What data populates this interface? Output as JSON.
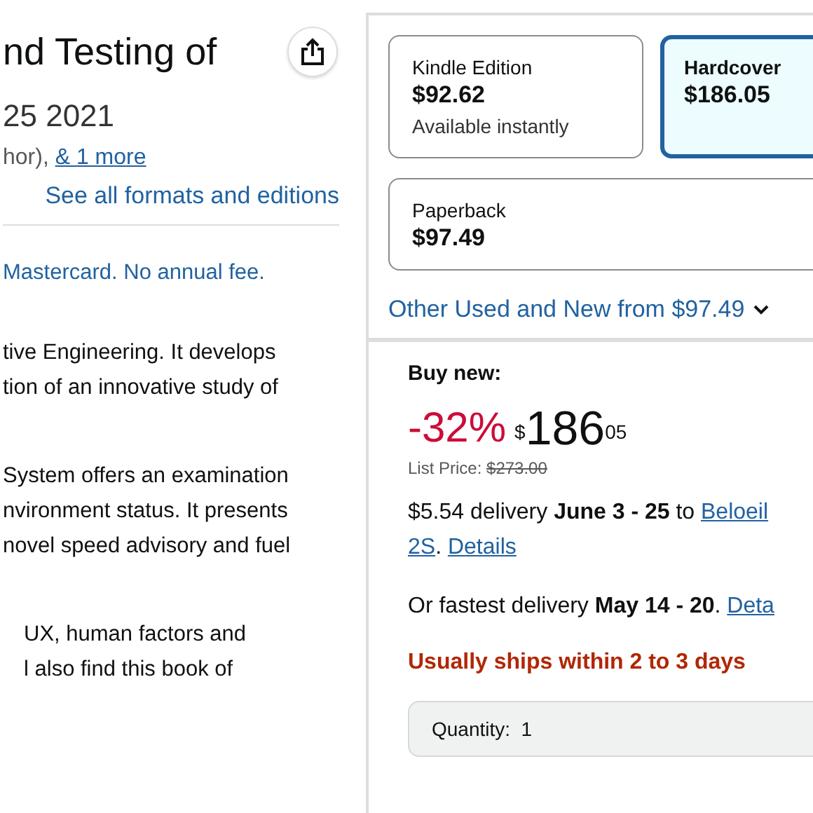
{
  "title": "nd Testing of",
  "subtitle": "25 2021",
  "byline": {
    "text": "hor), ",
    "link": "& 1 more"
  },
  "formats_link": "See all formats and editions",
  "card_offer": "Mastercard. No annual fee.",
  "description": [
    {
      "lines": [
        "tive Engineering. It develops",
        "tion of an innovative study of"
      ],
      "indent": false
    },
    {
      "lines": [
        "System offers an examination",
        "nvironment status. It presents",
        "novel speed advisory and fuel"
      ],
      "indent": false
    },
    {
      "lines": [
        "UX, human factors and",
        "l also find this book of"
      ],
      "indent": true
    }
  ],
  "formats": [
    {
      "name": "Kindle Edition",
      "price": "$92.62",
      "note": "Available instantly",
      "selected": false
    },
    {
      "name": "Hardcover",
      "price": "$186.05",
      "selected": true
    },
    {
      "name": "Paperback",
      "price": "$97.49",
      "selected": false
    }
  ],
  "other_offers": "Other Used and New from $97.49",
  "buy_new": "Buy new:",
  "discount": "-32%",
  "price": {
    "symbol": "$",
    "whole": "186",
    "fraction": "05"
  },
  "list_price": {
    "label": "List Price: ",
    "value": "$273.00"
  },
  "delivery": [
    [
      {
        "text": "$5.54 delivery **June 3 - 25** to "
      },
      {
        "link": "Beloeil"
      }
    ],
    [
      {
        "link": "2S"
      },
      {
        "text": ". "
      },
      {
        "link": "Details"
      }
    ]
  ],
  "fastest": [
    {
      "text": "Or fastest delivery **May 14 - 20**. "
    },
    {
      "link": "Deta"
    }
  ],
  "availability": "Usually ships within 2 to 3 days",
  "quantity": "Quantity:  1"
}
